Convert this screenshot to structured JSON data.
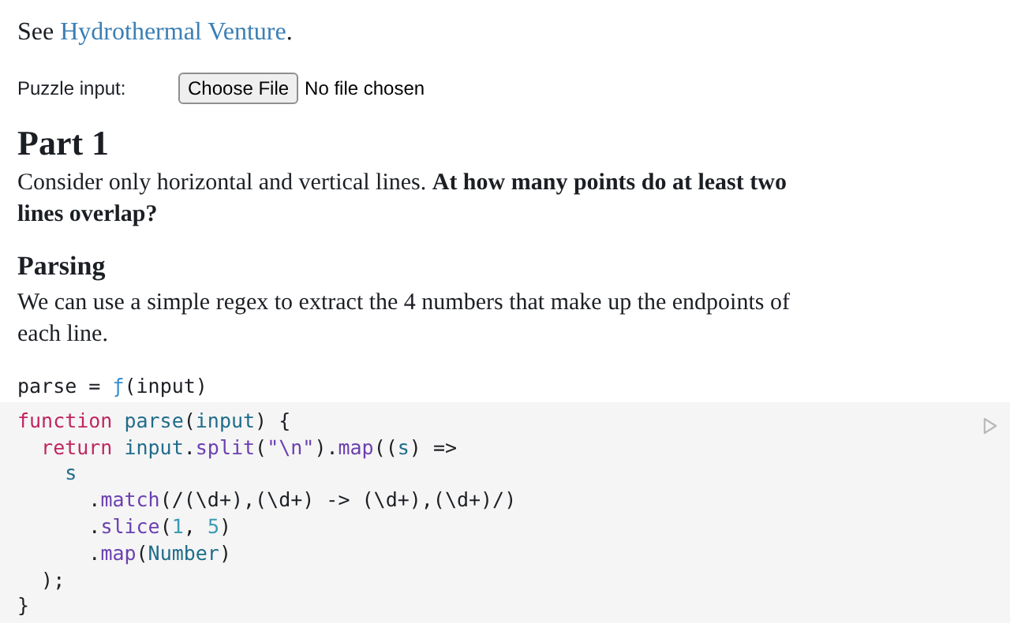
{
  "intro": {
    "before": "See ",
    "link": "Hydrothermal Venture",
    "after": "."
  },
  "file_input": {
    "label": "Puzzle input:",
    "button": "Choose File",
    "status": "No file chosen"
  },
  "sections": [
    {
      "kind": "h2",
      "text": "Part 1"
    },
    {
      "kind": "p",
      "text": "Consider only horizontal and vertical lines. **At how many points do at least two lines overlap?**"
    },
    {
      "kind": "h3",
      "text": "Parsing"
    },
    {
      "kind": "p",
      "text": "We can use a simple regex to extract the 4 numbers that make up the endpoints of each line."
    }
  ],
  "cell": {
    "header": [
      {
        "text": "parse = ",
        "kind": "plain"
      },
      {
        "text": "ƒ",
        "kind": "fn"
      },
      {
        "text": "(input)",
        "kind": "plain"
      }
    ],
    "code": [
      [
        {
          "text": "function ",
          "kind": "keyword"
        },
        {
          "text": "parse",
          "kind": "def"
        },
        {
          "text": "(",
          "kind": "plain"
        },
        {
          "text": "input",
          "kind": "var"
        },
        {
          "text": ") {",
          "kind": "plain"
        }
      ],
      [
        {
          "text": "  return ",
          "kind": "keyword"
        },
        {
          "text": "input",
          "kind": "var"
        },
        {
          "text": ".",
          "kind": "plain"
        },
        {
          "text": "split",
          "kind": "method"
        },
        {
          "text": "(",
          "kind": "plain"
        },
        {
          "text": "\"\\n\"",
          "kind": "string"
        },
        {
          "text": ").",
          "kind": "plain"
        },
        {
          "text": "map",
          "kind": "method"
        },
        {
          "text": "((",
          "kind": "plain"
        },
        {
          "text": "s",
          "kind": "var"
        },
        {
          "text": ") =>",
          "kind": "plain"
        }
      ],
      [
        {
          "text": "    s",
          "kind": "var"
        }
      ],
      [
        {
          "text": "      .",
          "kind": "plain"
        },
        {
          "text": "match",
          "kind": "method"
        },
        {
          "text": "(/(\\d+),(\\d+) -> (\\d+),(\\d+)/)",
          "kind": "plain"
        }
      ],
      [
        {
          "text": "      .",
          "kind": "plain"
        },
        {
          "text": "slice",
          "kind": "method"
        },
        {
          "text": "(",
          "kind": "plain"
        },
        {
          "text": "1",
          "kind": "number"
        },
        {
          "text": ", ",
          "kind": "plain"
        },
        {
          "text": "5",
          "kind": "number"
        },
        {
          "text": ")",
          "kind": "plain"
        }
      ],
      [
        {
          "text": "      .",
          "kind": "plain"
        },
        {
          "text": "map",
          "kind": "method"
        },
        {
          "text": "(",
          "kind": "plain"
        },
        {
          "text": "Number",
          "kind": "var"
        },
        {
          "text": ")",
          "kind": "plain"
        }
      ],
      [
        {
          "text": "  );",
          "kind": "plain"
        }
      ],
      [
        {
          "text": "}",
          "kind": "plain"
        }
      ]
    ]
  }
}
